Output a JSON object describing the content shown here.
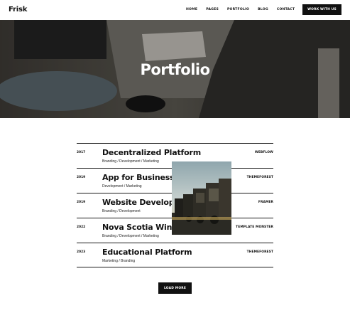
{
  "header": {
    "logo": "Frisk",
    "nav": [
      "HOME",
      "PAGES",
      "PORTFOLIO",
      "BLOG",
      "CONTACT"
    ],
    "cta_label": "WORK WITH US"
  },
  "hero": {
    "title": "Portfolio"
  },
  "portfolio": {
    "items": [
      {
        "year": "2017",
        "title": "Decentralized Platform",
        "categories": "Branding / Development / Marketing",
        "client": "WEBFLOW"
      },
      {
        "year": "2019",
        "title": "App for Business",
        "categories": "Development / Marketing",
        "client": "THEMEFOREST"
      },
      {
        "year": "2019",
        "title": "Website Development",
        "categories": "Branding / Development",
        "client": "FRAMER"
      },
      {
        "year": "2022",
        "title": "Nova Scotia Wine",
        "categories": "Branding / Development / Marketing",
        "client": "TEMPLATE MONSTER"
      },
      {
        "year": "2023",
        "title": "Educational Platform",
        "categories": "Marketing / Branding",
        "client": "THEMEFOREST"
      }
    ]
  },
  "load_more_label": "LOAD MORE",
  "colors": {
    "primary": "#111111",
    "background": "#ffffff",
    "hero_overlay": "#3a3530"
  }
}
